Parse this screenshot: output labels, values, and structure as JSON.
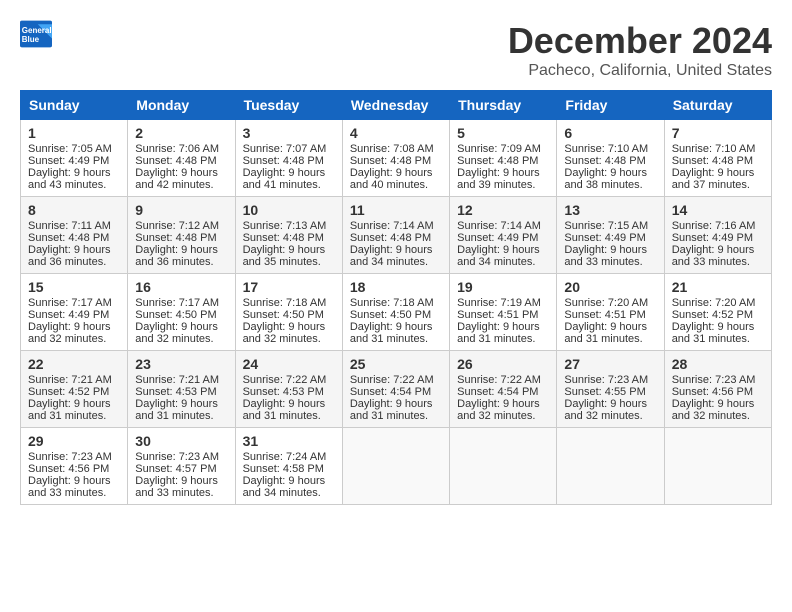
{
  "logo": {
    "line1": "General",
    "line2": "Blue"
  },
  "title": "December 2024",
  "subtitle": "Pacheco, California, United States",
  "days_header": [
    "Sunday",
    "Monday",
    "Tuesday",
    "Wednesday",
    "Thursday",
    "Friday",
    "Saturday"
  ],
  "weeks": [
    [
      {
        "day": "1",
        "sunrise": "Sunrise: 7:05 AM",
        "sunset": "Sunset: 4:49 PM",
        "daylight": "Daylight: 9 hours and 43 minutes."
      },
      {
        "day": "2",
        "sunrise": "Sunrise: 7:06 AM",
        "sunset": "Sunset: 4:48 PM",
        "daylight": "Daylight: 9 hours and 42 minutes."
      },
      {
        "day": "3",
        "sunrise": "Sunrise: 7:07 AM",
        "sunset": "Sunset: 4:48 PM",
        "daylight": "Daylight: 9 hours and 41 minutes."
      },
      {
        "day": "4",
        "sunrise": "Sunrise: 7:08 AM",
        "sunset": "Sunset: 4:48 PM",
        "daylight": "Daylight: 9 hours and 40 minutes."
      },
      {
        "day": "5",
        "sunrise": "Sunrise: 7:09 AM",
        "sunset": "Sunset: 4:48 PM",
        "daylight": "Daylight: 9 hours and 39 minutes."
      },
      {
        "day": "6",
        "sunrise": "Sunrise: 7:10 AM",
        "sunset": "Sunset: 4:48 PM",
        "daylight": "Daylight: 9 hours and 38 minutes."
      },
      {
        "day": "7",
        "sunrise": "Sunrise: 7:10 AM",
        "sunset": "Sunset: 4:48 PM",
        "daylight": "Daylight: 9 hours and 37 minutes."
      }
    ],
    [
      {
        "day": "8",
        "sunrise": "Sunrise: 7:11 AM",
        "sunset": "Sunset: 4:48 PM",
        "daylight": "Daylight: 9 hours and 36 minutes."
      },
      {
        "day": "9",
        "sunrise": "Sunrise: 7:12 AM",
        "sunset": "Sunset: 4:48 PM",
        "daylight": "Daylight: 9 hours and 36 minutes."
      },
      {
        "day": "10",
        "sunrise": "Sunrise: 7:13 AM",
        "sunset": "Sunset: 4:48 PM",
        "daylight": "Daylight: 9 hours and 35 minutes."
      },
      {
        "day": "11",
        "sunrise": "Sunrise: 7:14 AM",
        "sunset": "Sunset: 4:48 PM",
        "daylight": "Daylight: 9 hours and 34 minutes."
      },
      {
        "day": "12",
        "sunrise": "Sunrise: 7:14 AM",
        "sunset": "Sunset: 4:49 PM",
        "daylight": "Daylight: 9 hours and 34 minutes."
      },
      {
        "day": "13",
        "sunrise": "Sunrise: 7:15 AM",
        "sunset": "Sunset: 4:49 PM",
        "daylight": "Daylight: 9 hours and 33 minutes."
      },
      {
        "day": "14",
        "sunrise": "Sunrise: 7:16 AM",
        "sunset": "Sunset: 4:49 PM",
        "daylight": "Daylight: 9 hours and 33 minutes."
      }
    ],
    [
      {
        "day": "15",
        "sunrise": "Sunrise: 7:17 AM",
        "sunset": "Sunset: 4:49 PM",
        "daylight": "Daylight: 9 hours and 32 minutes."
      },
      {
        "day": "16",
        "sunrise": "Sunrise: 7:17 AM",
        "sunset": "Sunset: 4:50 PM",
        "daylight": "Daylight: 9 hours and 32 minutes."
      },
      {
        "day": "17",
        "sunrise": "Sunrise: 7:18 AM",
        "sunset": "Sunset: 4:50 PM",
        "daylight": "Daylight: 9 hours and 32 minutes."
      },
      {
        "day": "18",
        "sunrise": "Sunrise: 7:18 AM",
        "sunset": "Sunset: 4:50 PM",
        "daylight": "Daylight: 9 hours and 31 minutes."
      },
      {
        "day": "19",
        "sunrise": "Sunrise: 7:19 AM",
        "sunset": "Sunset: 4:51 PM",
        "daylight": "Daylight: 9 hours and 31 minutes."
      },
      {
        "day": "20",
        "sunrise": "Sunrise: 7:20 AM",
        "sunset": "Sunset: 4:51 PM",
        "daylight": "Daylight: 9 hours and 31 minutes."
      },
      {
        "day": "21",
        "sunrise": "Sunrise: 7:20 AM",
        "sunset": "Sunset: 4:52 PM",
        "daylight": "Daylight: 9 hours and 31 minutes."
      }
    ],
    [
      {
        "day": "22",
        "sunrise": "Sunrise: 7:21 AM",
        "sunset": "Sunset: 4:52 PM",
        "daylight": "Daylight: 9 hours and 31 minutes."
      },
      {
        "day": "23",
        "sunrise": "Sunrise: 7:21 AM",
        "sunset": "Sunset: 4:53 PM",
        "daylight": "Daylight: 9 hours and 31 minutes."
      },
      {
        "day": "24",
        "sunrise": "Sunrise: 7:22 AM",
        "sunset": "Sunset: 4:53 PM",
        "daylight": "Daylight: 9 hours and 31 minutes."
      },
      {
        "day": "25",
        "sunrise": "Sunrise: 7:22 AM",
        "sunset": "Sunset: 4:54 PM",
        "daylight": "Daylight: 9 hours and 31 minutes."
      },
      {
        "day": "26",
        "sunrise": "Sunrise: 7:22 AM",
        "sunset": "Sunset: 4:54 PM",
        "daylight": "Daylight: 9 hours and 32 minutes."
      },
      {
        "day": "27",
        "sunrise": "Sunrise: 7:23 AM",
        "sunset": "Sunset: 4:55 PM",
        "daylight": "Daylight: 9 hours and 32 minutes."
      },
      {
        "day": "28",
        "sunrise": "Sunrise: 7:23 AM",
        "sunset": "Sunset: 4:56 PM",
        "daylight": "Daylight: 9 hours and 32 minutes."
      }
    ],
    [
      {
        "day": "29",
        "sunrise": "Sunrise: 7:23 AM",
        "sunset": "Sunset: 4:56 PM",
        "daylight": "Daylight: 9 hours and 33 minutes."
      },
      {
        "day": "30",
        "sunrise": "Sunrise: 7:23 AM",
        "sunset": "Sunset: 4:57 PM",
        "daylight": "Daylight: 9 hours and 33 minutes."
      },
      {
        "day": "31",
        "sunrise": "Sunrise: 7:24 AM",
        "sunset": "Sunset: 4:58 PM",
        "daylight": "Daylight: 9 hours and 34 minutes."
      },
      null,
      null,
      null,
      null
    ]
  ]
}
